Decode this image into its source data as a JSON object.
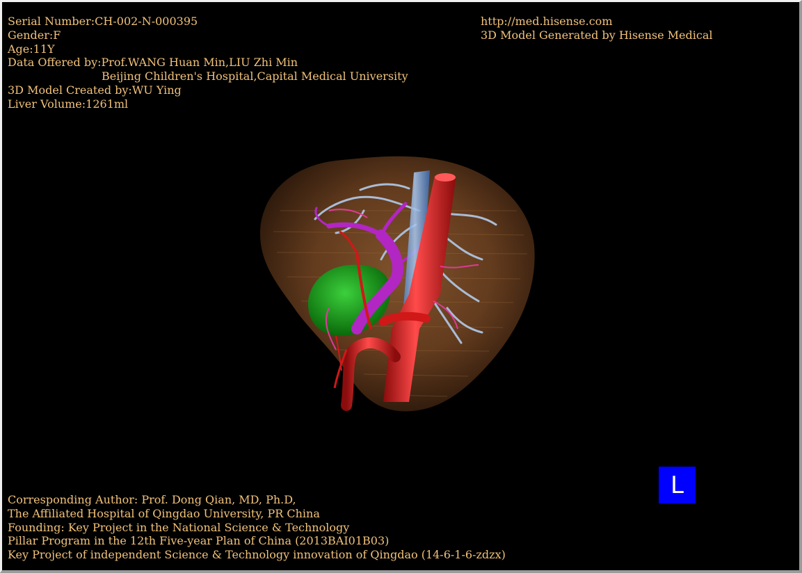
{
  "header_left": {
    "serial": "Serial Number:CH-002-N-000395",
    "gender": "Gender:F",
    "age": "Age:11Y",
    "data_offered": "Data Offered by:Prof.WANG Huan Min,LIU Zhi Min",
    "institution": "Beijing Children's Hospital,Capital Medical University",
    "model_created": "3D Model Created by:WU Ying",
    "liver_volume": "Liver Volume:1261ml"
  },
  "header_right": {
    "url": "http://med.hisense.com",
    "generated": "3D Model Generated by Hisense Medical"
  },
  "footer": {
    "line1": "Corresponding Author: Prof. Dong Qian, MD, Ph.D,",
    "line2": "The Affiliated Hospital of Qingdao University, PR China",
    "line3": "Founding: Key Project in the National Science & Technology",
    "line4": "Pillar Program in the 12th Five-year Plan of China (2013BAI01B03)",
    "line5": "Key Project of independent Science & Technology innovation of Qingdao (14-6-1-6-zdzx)"
  },
  "orientation_marker": "L",
  "colors": {
    "text": "#f1c27a",
    "background": "#000000",
    "liver": "#7a4a24",
    "artery": "#e02020",
    "portal_vein": "#b020c0",
    "hepatic_vein": "#9fb4d0",
    "gallbladder": "#1aa21a",
    "ivc": "#6fa0e0",
    "marker": "#0000ff"
  }
}
